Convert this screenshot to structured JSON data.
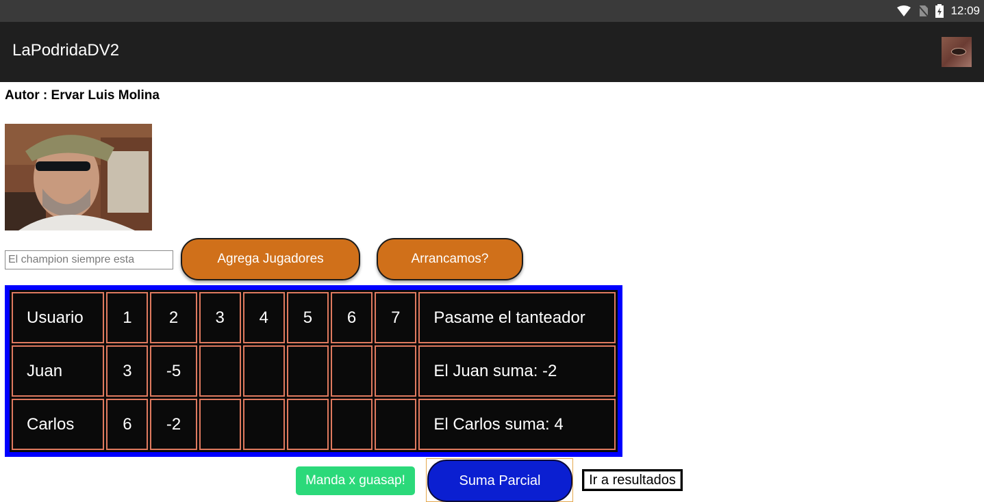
{
  "status_bar": {
    "time": "12:09",
    "icons": [
      "wifi-icon",
      "no-sim-icon",
      "battery-charging-icon"
    ]
  },
  "app_bar": {
    "title": "LaPodridaDV2",
    "avatar_icon": "profile-avatar"
  },
  "author_label": "Autor : Ervar Luis Molina",
  "player_input": {
    "value": "",
    "placeholder": "El champion siempre esta"
  },
  "buttons": {
    "add_players": "Agrega Jugadores",
    "start": "Arrancamos?",
    "whatsapp": "Manda x guasap!",
    "partial_sum": "Suma Parcial",
    "results": "Ir a resultados"
  },
  "score_table": {
    "headers": [
      "Usuario",
      "1",
      "2",
      "3",
      "4",
      "5",
      "6",
      "7",
      "Pasame el tanteador"
    ],
    "rows": [
      [
        "Juan",
        "3",
        "-5",
        "",
        "",
        "",
        "",
        "",
        "El Juan suma: -2"
      ],
      [
        "Carlos",
        "6",
        "-2",
        "",
        "",
        "",
        "",
        "",
        "El Carlos suma: 4"
      ]
    ]
  },
  "colors": {
    "orange_button": "#d0701a",
    "table_frame": "#0000ff",
    "cell_border": "#e07a5f",
    "whatsapp_green": "#2bd97a",
    "suma_blue": "#0b1fd1"
  }
}
